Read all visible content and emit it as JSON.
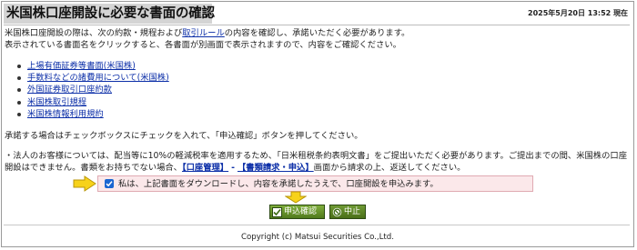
{
  "header": {
    "title": "米国株口座開設に必要な書面の確認",
    "timestamp": "2025年5月20日 13:52 現在"
  },
  "intro": {
    "line1_prefix": "米国株口座開設の際は、次の約款・規程および",
    "line1_link": "取引ルール",
    "line1_suffix": "の内容を確認し、承諾いただく必要があります。",
    "line2": "表示されている書面名をクリックすると、各書面が別画面で表示されますので、内容をご確認ください。"
  },
  "documents": [
    {
      "label": "上場有価証券等書面(米国株)"
    },
    {
      "label": "手数料などの諸費用について(米国株)"
    },
    {
      "label": "外国証券取引口座約款"
    },
    {
      "label": "米国株取引規程"
    },
    {
      "label": "米国株情報利用規約"
    }
  ],
  "instruction": "承諾する場合はチェックボックスにチェックを入れて、「申込確認」ボタンを押してください。",
  "notice": {
    "line1": "・法人のお客様については、配当等に10%の軽減税率を適用するため、「日米租税条約表明文書」をご提出いただく必要があります。ご提出までの間、米国株の口座",
    "line2_prefix": "開設はできません。書類をお持ちでない場合、",
    "link_account": "【口座管理】",
    "separator": "-",
    "link_documents": "【書類請求・申込】",
    "line2_suffix": "画面から請求の上、返送してください。"
  },
  "consent": {
    "checked": true,
    "label": "私は、上記書面をダウンロードし、内容を承諾したうえで、口座開設を申込みます。"
  },
  "buttons": {
    "apply_label": "申込確認",
    "cancel_label": "中止"
  },
  "footer": {
    "copyright": "Copyright (c) Matsui Securities Co.,Ltd."
  },
  "colors": {
    "link": "#0c2fa8",
    "title_bg": "#d4d4d4",
    "consent_bg": "#fbe8ea",
    "button_green": "#5f8a26",
    "arrow_yellow": "#f7d21a"
  }
}
